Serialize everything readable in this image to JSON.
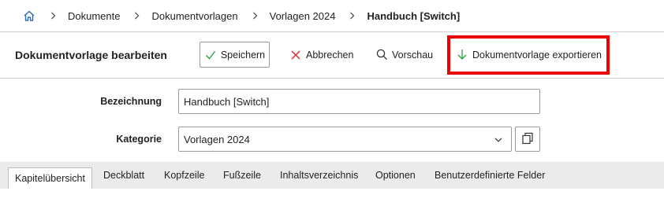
{
  "breadcrumb": {
    "home_icon": "home-icon",
    "items": [
      {
        "label": "Dokumente"
      },
      {
        "label": "Dokumentvorlagen"
      },
      {
        "label": "Vorlagen 2024"
      },
      {
        "label": "Handbuch [Switch]"
      }
    ]
  },
  "header": {
    "title": "Dokumentvorlage bearbeiten",
    "actions": {
      "save": {
        "label": "Speichern",
        "icon": "check-icon",
        "color": "#2e9b3e"
      },
      "cancel": {
        "label": "Abbrechen",
        "icon": "close-icon",
        "color": "#e02020"
      },
      "preview": {
        "label": "Vorschau",
        "icon": "search-icon"
      },
      "export": {
        "label": "Dokumentvorlage exportieren",
        "icon": "download-arrow-icon",
        "color": "#2e9b3e"
      }
    },
    "highlight_color": "#ee0000"
  },
  "form": {
    "bezeichnung": {
      "label": "Bezeichnung",
      "value": "Handbuch [Switch]"
    },
    "kategorie": {
      "label": "Kategorie",
      "value": "Vorlagen 2024"
    }
  },
  "tabs": [
    {
      "label": "Kapitelübersicht",
      "active": true
    },
    {
      "label": "Deckblatt"
    },
    {
      "label": "Kopfzeile"
    },
    {
      "label": "Fußzeile"
    },
    {
      "label": "Inhaltsverzeichnis"
    },
    {
      "label": "Optionen"
    },
    {
      "label": "Benutzerdefinierte Felder"
    }
  ]
}
